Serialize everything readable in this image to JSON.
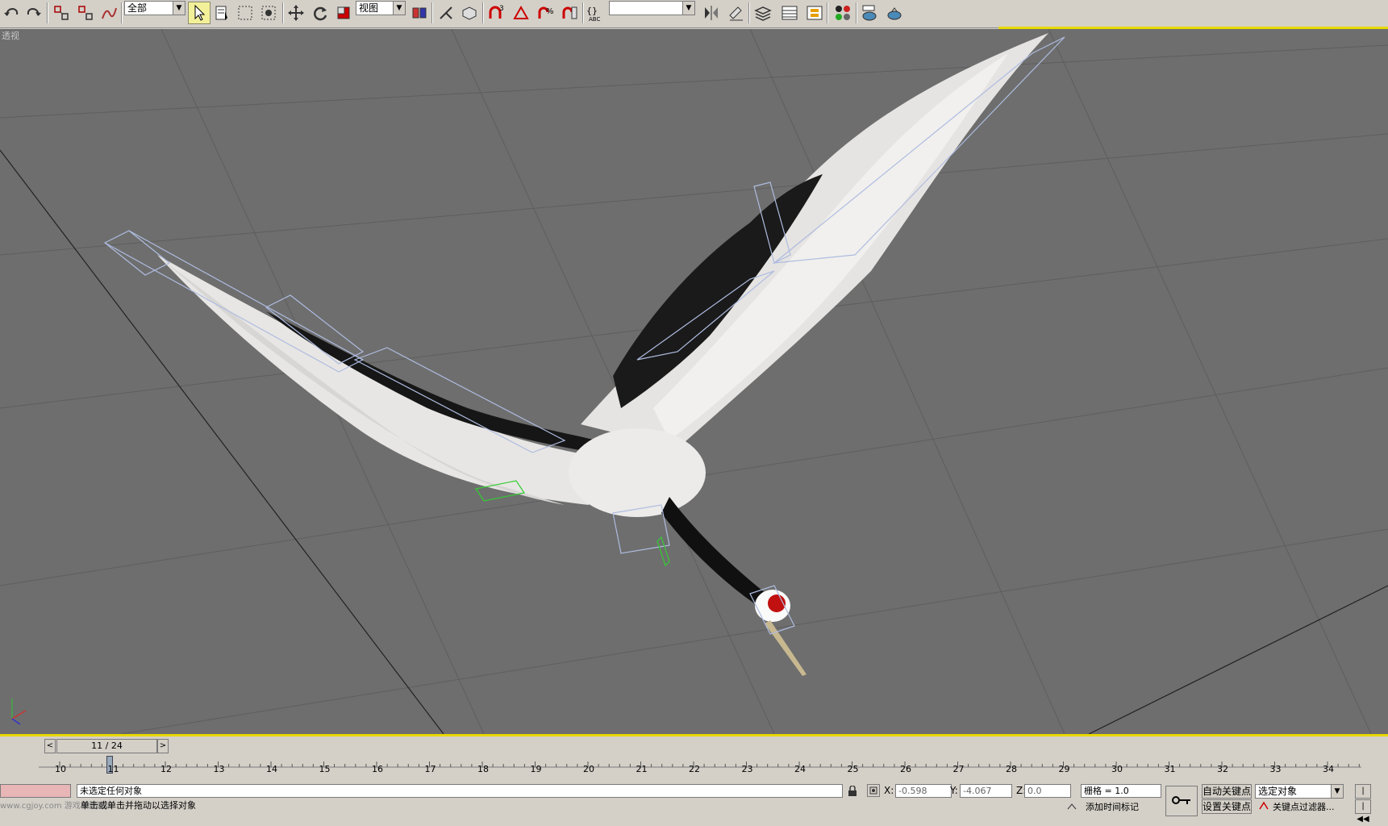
{
  "toolbar": {
    "selection_filter": "全部",
    "reference_coord": "视图",
    "named_selection": "",
    "icons": [
      "undo-icon",
      "redo-icon",
      "link-icon",
      "unlink-icon",
      "bind-spacewarp-icon",
      "select-object-icon",
      "select-by-name-icon",
      "rect-selection-icon",
      "window-crossing-icon",
      "move-icon",
      "rotate-icon",
      "scale-icon",
      "pivot-icon",
      "manipulate-icon",
      "snap-3d-icon",
      "angle-snap-icon",
      "percent-snap-icon",
      "spinner-snap-icon",
      "edit-named-selection-icon",
      "mirror-icon",
      "align-icon",
      "layer-manager-icon",
      "curve-editor-icon",
      "schematic-view-icon",
      "material-editor-icon",
      "render-setup-icon",
      "quick-render-icon"
    ]
  },
  "viewport": {
    "label": "透视",
    "background_color": "#6e6e6e"
  },
  "timeline": {
    "frame_counter": "11 / 24",
    "ticks": [
      "10",
      "11",
      "12",
      "13",
      "14",
      "15",
      "16",
      "17",
      "18",
      "19",
      "20",
      "21",
      "22",
      "23",
      "24",
      "25",
      "26",
      "27",
      "28",
      "29",
      "30",
      "31",
      "32",
      "33",
      "34"
    ]
  },
  "status": {
    "message1": "未选定任何对象",
    "message2": "单击或单击并拖动以选择对象",
    "watermark": "www.cgjoy.com 游戏模型论坛",
    "x_value": "-0.598",
    "y_value": "-4.067",
    "z_value": "0.0",
    "x_label": "X:",
    "y_label": "Y:",
    "z_label": "Z:",
    "grid": "栅格 = 1.0",
    "add_time_tag": "添加时间标记",
    "auto_key": "自动关键点",
    "set_key": "设置关键点",
    "selected_objects": "选定对象",
    "key_filters": "关键点过滤器..."
  }
}
